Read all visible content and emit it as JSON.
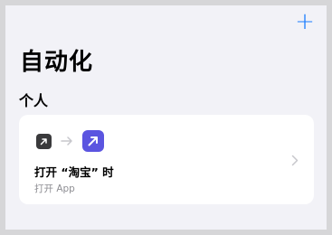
{
  "header": {
    "add_label": "+"
  },
  "page": {
    "title": "自动化"
  },
  "section": {
    "title": "个人"
  },
  "automation": {
    "title": "打开 “淘宝” 时",
    "subtitle": "打开 App",
    "icons": [
      "open-app-icon",
      "arrow-right-icon",
      "open-app-shortcut-icon"
    ]
  },
  "colors": {
    "accent": "#1a7cff",
    "background": "#f2f2f7",
    "card": "#ffffff",
    "shortcut_icon": "#5b55e0",
    "small_icon": "#3a3a3c",
    "secondary_text": "#8e8e93"
  }
}
